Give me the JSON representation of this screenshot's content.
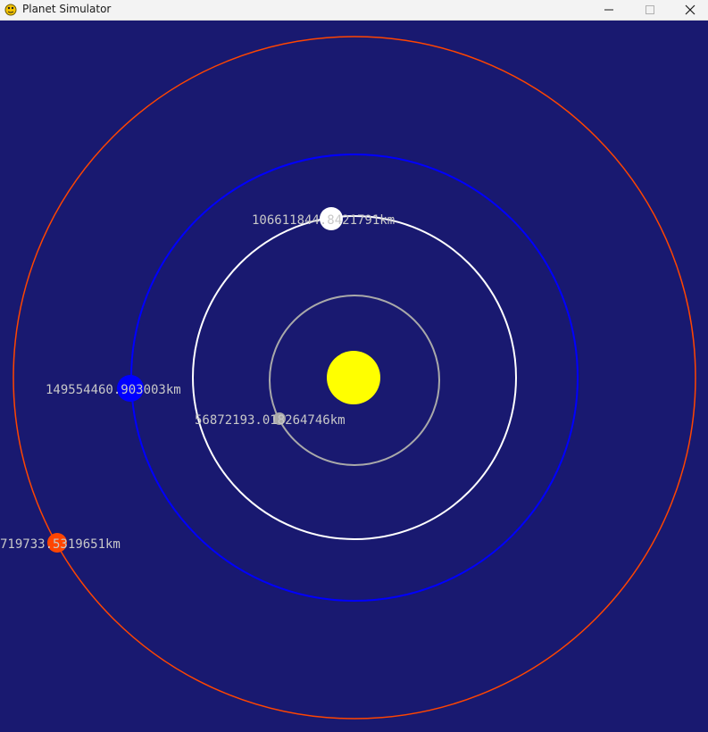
{
  "window": {
    "title": "Planet Simulator",
    "icon": "pygame-snake-icon",
    "controls": [
      "minimize-icon",
      "maximize-icon",
      "close-icon"
    ]
  },
  "simulation": {
    "background_color": "#191970",
    "sun": {
      "name": "sun",
      "color": "#FFFF00"
    },
    "planets": [
      {
        "name": "mercury",
        "color": "#A9A9A9",
        "orbit_color": "#A9A9A9",
        "distance_label": "56872193.018264746km"
      },
      {
        "name": "venus",
        "color": "#FFFFFF",
        "orbit_color": "#FFFFFF",
        "distance_label": "106611844.8421791km"
      },
      {
        "name": "earth",
        "color": "#0000FF",
        "orbit_color": "#0000FF",
        "distance_label": "149554460.903003km"
      },
      {
        "name": "mars",
        "color": "#FF4500",
        "orbit_color": "#FF4500",
        "distance_label": "719733.5319651km"
      }
    ]
  }
}
